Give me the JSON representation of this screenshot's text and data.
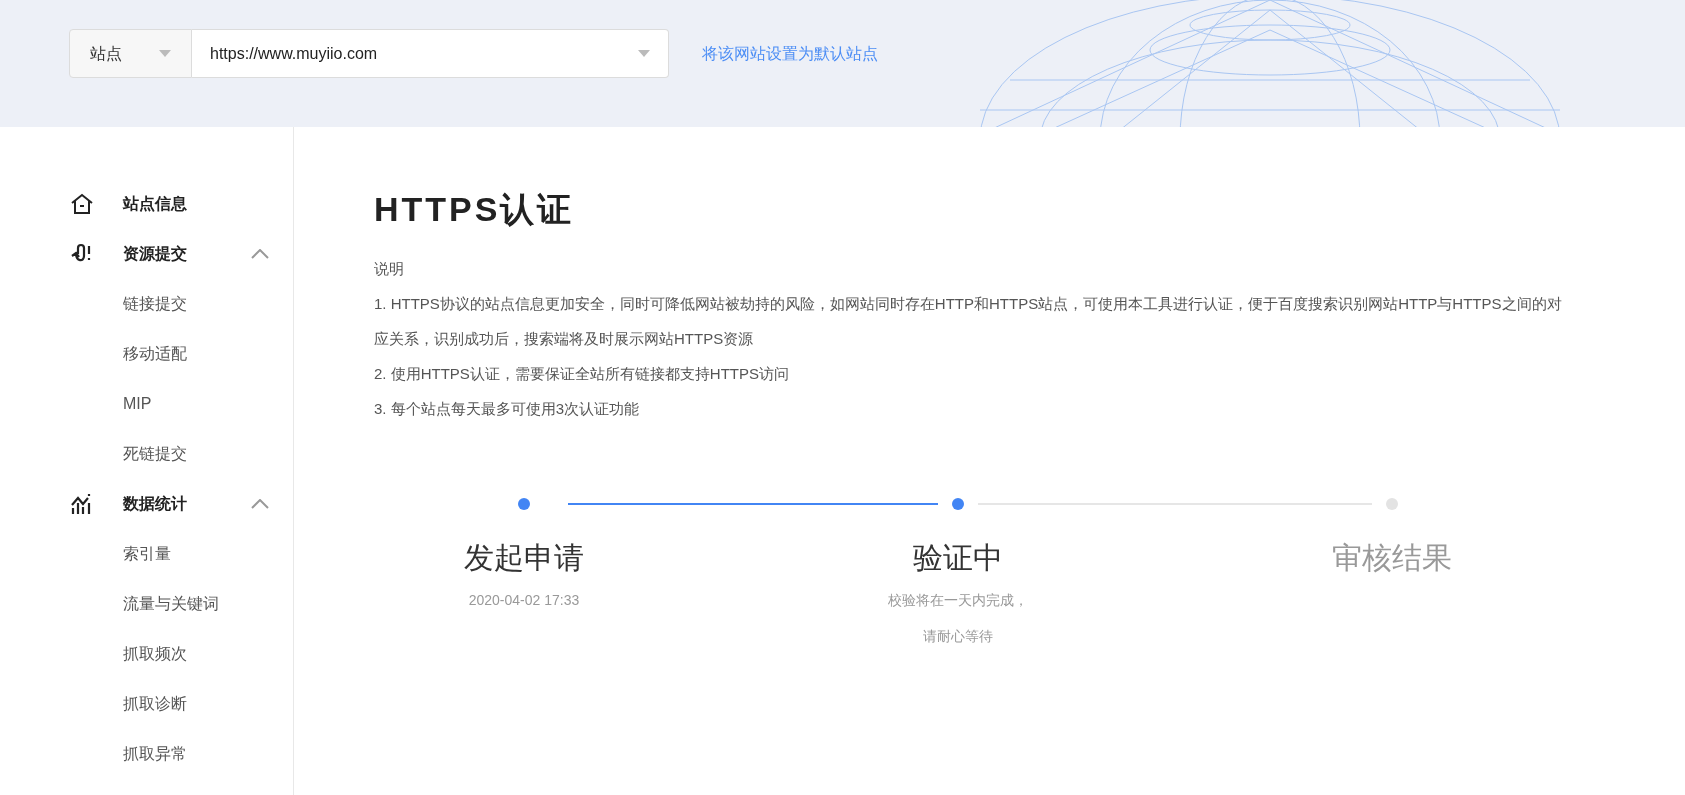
{
  "header": {
    "site_select": {
      "value": "站点"
    },
    "url_select": {
      "value": "https://www.muyiio.com"
    },
    "default_link": "将该网站设置为默认站点"
  },
  "sidebar": {
    "items": [
      {
        "label": "站点信息"
      },
      {
        "label": "资源提交",
        "expanded": true,
        "children": [
          {
            "label": "链接提交"
          },
          {
            "label": "移动适配"
          },
          {
            "label": "MIP"
          },
          {
            "label": "死链提交"
          }
        ]
      },
      {
        "label": "数据统计",
        "expanded": true,
        "children": [
          {
            "label": "索引量"
          },
          {
            "label": "流量与关键词"
          },
          {
            "label": "抓取频次"
          },
          {
            "label": "抓取诊断"
          },
          {
            "label": "抓取异常"
          }
        ]
      }
    ]
  },
  "main": {
    "title": "HTTPS认证",
    "description": [
      "说明",
      "1. HTTPS协议的站点信息更加安全，同时可降低网站被劫持的风险，如网站同时存在HTTP和HTTPS站点，可使用本工具进行认证，便于百度搜索识别网站HTTP与HTTPS之间的对应关系，识别成功后，搜索端将及时展示网站HTTPS资源",
      "2. 使用HTTPS认证，需要保证全站所有链接都支持HTTPS访问",
      "3. 每个站点每天最多可使用3次认证功能"
    ],
    "steps": [
      {
        "title": "发起申请",
        "kind": "done",
        "notes": [
          "2020-04-02 17:33"
        ]
      },
      {
        "title": "验证中",
        "kind": "active",
        "notes": [
          "校验将在一天内完成，",
          "请耐心等待"
        ]
      },
      {
        "title": "审核结果",
        "kind": "pending"
      }
    ]
  }
}
